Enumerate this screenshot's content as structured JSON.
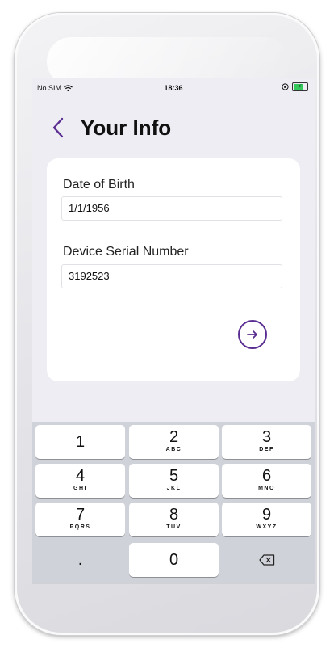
{
  "status_bar": {
    "carrier": "No SIM",
    "time": "18:36"
  },
  "nav": {
    "title": "Your Info"
  },
  "form": {
    "dob_label": "Date of Birth",
    "dob_value": "1/1/1956",
    "serial_label": "Device Serial Number",
    "serial_value": "3192523"
  },
  "colors": {
    "accent": "#5a2d91",
    "background": "#eeedf3",
    "keyboard": "#cfd2d8",
    "battery": "#34c759"
  },
  "keyboard": {
    "keys": [
      {
        "digit": "1",
        "letters": ""
      },
      {
        "digit": "2",
        "letters": "ABC"
      },
      {
        "digit": "3",
        "letters": "DEF"
      },
      {
        "digit": "4",
        "letters": "GHI"
      },
      {
        "digit": "5",
        "letters": "JKL"
      },
      {
        "digit": "6",
        "letters": "MNO"
      },
      {
        "digit": "7",
        "letters": "PQRS"
      },
      {
        "digit": "8",
        "letters": "TUV"
      },
      {
        "digit": "9",
        "letters": "WXYZ"
      }
    ],
    "decimal": ".",
    "zero": "0",
    "delete_icon": "backspace-icon"
  }
}
